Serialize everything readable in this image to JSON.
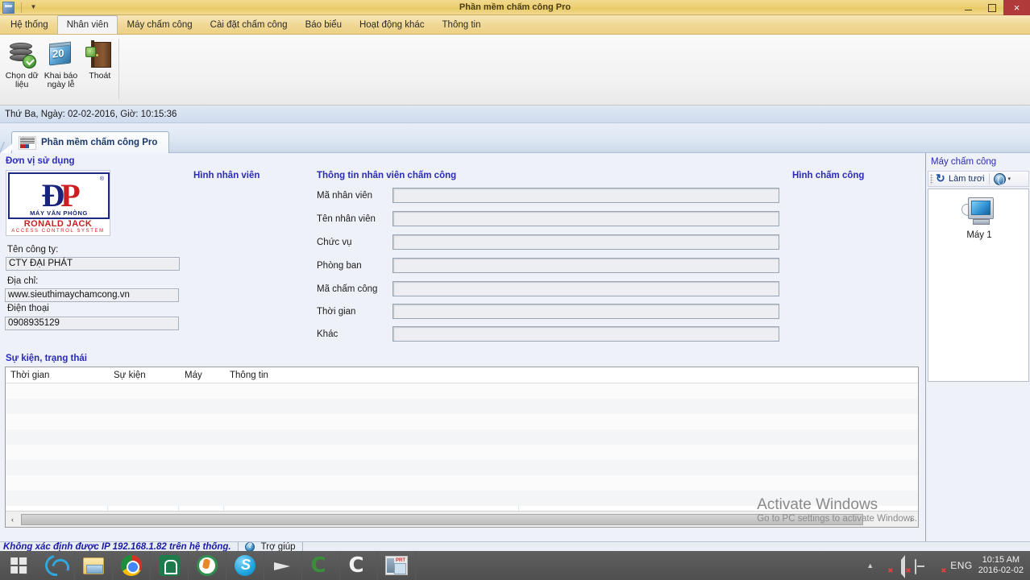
{
  "window": {
    "title": "Phần mềm chấm công Pro",
    "quick_access_dropdown": "▼",
    "minimize_label": "Minimize",
    "maximize_label": "Maximize",
    "close_label": "×"
  },
  "ribbon": {
    "tabs": [
      {
        "label": "Hệ thống",
        "active": false
      },
      {
        "label": "Nhân viên",
        "active": true
      },
      {
        "label": "Máy chấm công",
        "active": false
      },
      {
        "label": "Cài đặt chấm công",
        "active": false
      },
      {
        "label": "Báo biểu",
        "active": false
      },
      {
        "label": "Hoạt động khác",
        "active": false
      },
      {
        "label": "Thông tin",
        "active": false
      }
    ],
    "buttons": [
      {
        "label": "Chọn dữ\nliệu",
        "icon": "database-check-icon"
      },
      {
        "label": "Khai báo\nngày lễ",
        "icon": "calendar-icon",
        "day": "20"
      },
      {
        "label": "Thoát",
        "icon": "exit-door-icon"
      }
    ]
  },
  "datebar": {
    "text": "Thứ Ba, Ngày: 02-02-2016, Giờ: 10:15:36"
  },
  "doctab": {
    "label": "Phần mềm chấm công Pro"
  },
  "company": {
    "section_title": "Đơn vị sử dụng",
    "logo": {
      "mark_d": "Đ",
      "mark_p": "P",
      "registered": "®",
      "sub1": "MÁY VĂN PHÒNG",
      "sub2": "RONALD JACK",
      "sub3": "ACCESS CONTROL SYSTEM"
    },
    "fields": [
      {
        "label": "Tên công ty:",
        "value": "CTY ĐẠI PHÁT"
      },
      {
        "label": "Địa chỉ:",
        "value": "www.sieuthimaychamcong.vn"
      },
      {
        "label": "Điện thoại",
        "value": "0908935129"
      }
    ]
  },
  "photo_section": {
    "title": "Hình nhân viên"
  },
  "attendance_photo_section": {
    "title": "Hình chấm công"
  },
  "employee_form": {
    "title": "Thông tin nhân viên chấm công",
    "rows": [
      {
        "label": "Mã nhân viên",
        "value": ""
      },
      {
        "label": "Tên nhân viên",
        "value": ""
      },
      {
        "label": "Chức vụ",
        "value": ""
      },
      {
        "label": "Phòng ban",
        "value": ""
      },
      {
        "label": "Mã chấm công",
        "value": ""
      },
      {
        "label": "Thời gian",
        "value": ""
      },
      {
        "label": "Khác",
        "value": ""
      }
    ]
  },
  "events": {
    "title": "Sự kiện, trạng thái",
    "columns": [
      "Thời gian",
      "Sự kiện",
      "Máy",
      "Thông tin"
    ],
    "rows": [],
    "scroll_left_label": "‹",
    "scroll_right_label": "›"
  },
  "devices": {
    "title": "Máy chấm công",
    "refresh_label": "Làm tươi",
    "dropdown_caret": "▾",
    "items": [
      {
        "label": "Máy 1",
        "icon": "attendance-machine-icon"
      }
    ]
  },
  "watermark": {
    "line1": "Activate Windows",
    "line2": "Go to PC settings to activate Windows."
  },
  "statusbar": {
    "message": "Không xác định được IP 192.168.1.82 trên hệ thống.",
    "help_label": "Trợ giúp"
  },
  "taskbar": {
    "start_label": "Start",
    "items": [
      {
        "name": "internet-explorer-icon"
      },
      {
        "name": "file-explorer-icon"
      },
      {
        "name": "chrome-icon"
      },
      {
        "name": "green-house-app-icon"
      },
      {
        "name": "ring-app-icon"
      },
      {
        "name": "skype-icon"
      },
      {
        "name": "paper-plane-icon"
      },
      {
        "name": "coccoc-browser-icon"
      },
      {
        "name": "coccoc-browser-light-icon"
      },
      {
        "name": "printer-photo-icon"
      }
    ],
    "tray": {
      "overflow_caret": "▲",
      "language": "ENG",
      "time": "10:15 AM",
      "date": "2016-02-02"
    }
  },
  "colors": {
    "titlebar": "#eccf73",
    "ribbon": "#f0d794",
    "section_heading": "#2b2bb5",
    "status_text": "#1a1aa8",
    "close_button": "#b03a3a"
  }
}
